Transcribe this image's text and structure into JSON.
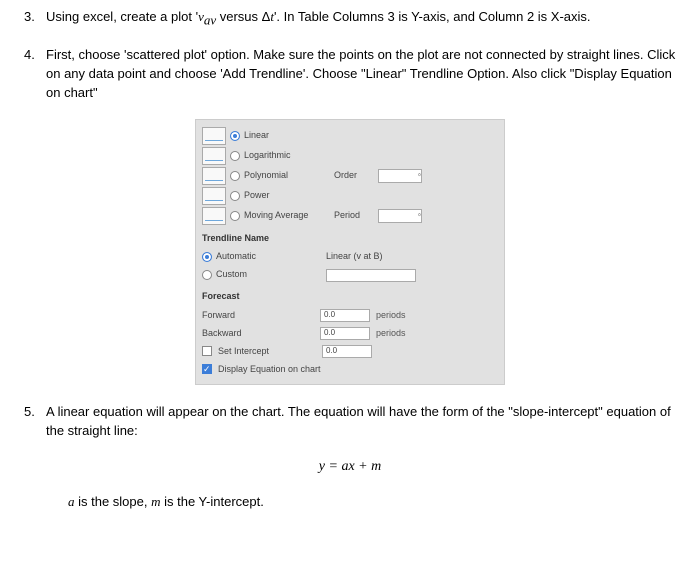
{
  "items": [
    {
      "num": "3.",
      "text_pre": "Using excel, create a plot '",
      "var1": "v",
      "sub1": "av",
      "text_mid": " versus Δ",
      "var2": "t",
      "text_post": "'. In Table Columns 3 is Y-axis, and Column 2 is X-axis."
    },
    {
      "num": "4.",
      "text": "First, choose 'scattered plot' option. Make sure the points on the plot are not connected by straight lines. Click on any data point and choose 'Add Trendline'. Choose \"Linear\" Trendline Option. Also click \"Display Equation on chart\""
    },
    {
      "num": "5.",
      "text": "A linear equation will appear on the chart. The equation will have the form of the \"slope-intercept\" equation of the straight line:"
    }
  ],
  "panel": {
    "opts": {
      "linear": "Linear",
      "log": "Logarithmic",
      "poly": "Polynomial",
      "power": "Power",
      "mavg": "Moving Average",
      "order_label": "Order",
      "period_label": "Period"
    },
    "tname_hd": "Trendline Name",
    "tname": {
      "auto": "Automatic",
      "auto_val": "Linear (v at B)",
      "custom": "Custom"
    },
    "forecast_hd": "Forecast",
    "forecast": {
      "fwd": "Forward",
      "fwd_val": "0.0",
      "fwd_unit": "periods",
      "bwd": "Backward",
      "bwd_val": "0.0",
      "bwd_unit": "periods",
      "intercept": "Set Intercept",
      "intercept_val": "0.0",
      "display_eq": "Display Equation on chart"
    }
  },
  "equation": "y = ax + m",
  "remark": {
    "a": "a",
    "t1": " is the slope, ",
    "m": "m",
    "t2": " is the Y-intercept."
  }
}
